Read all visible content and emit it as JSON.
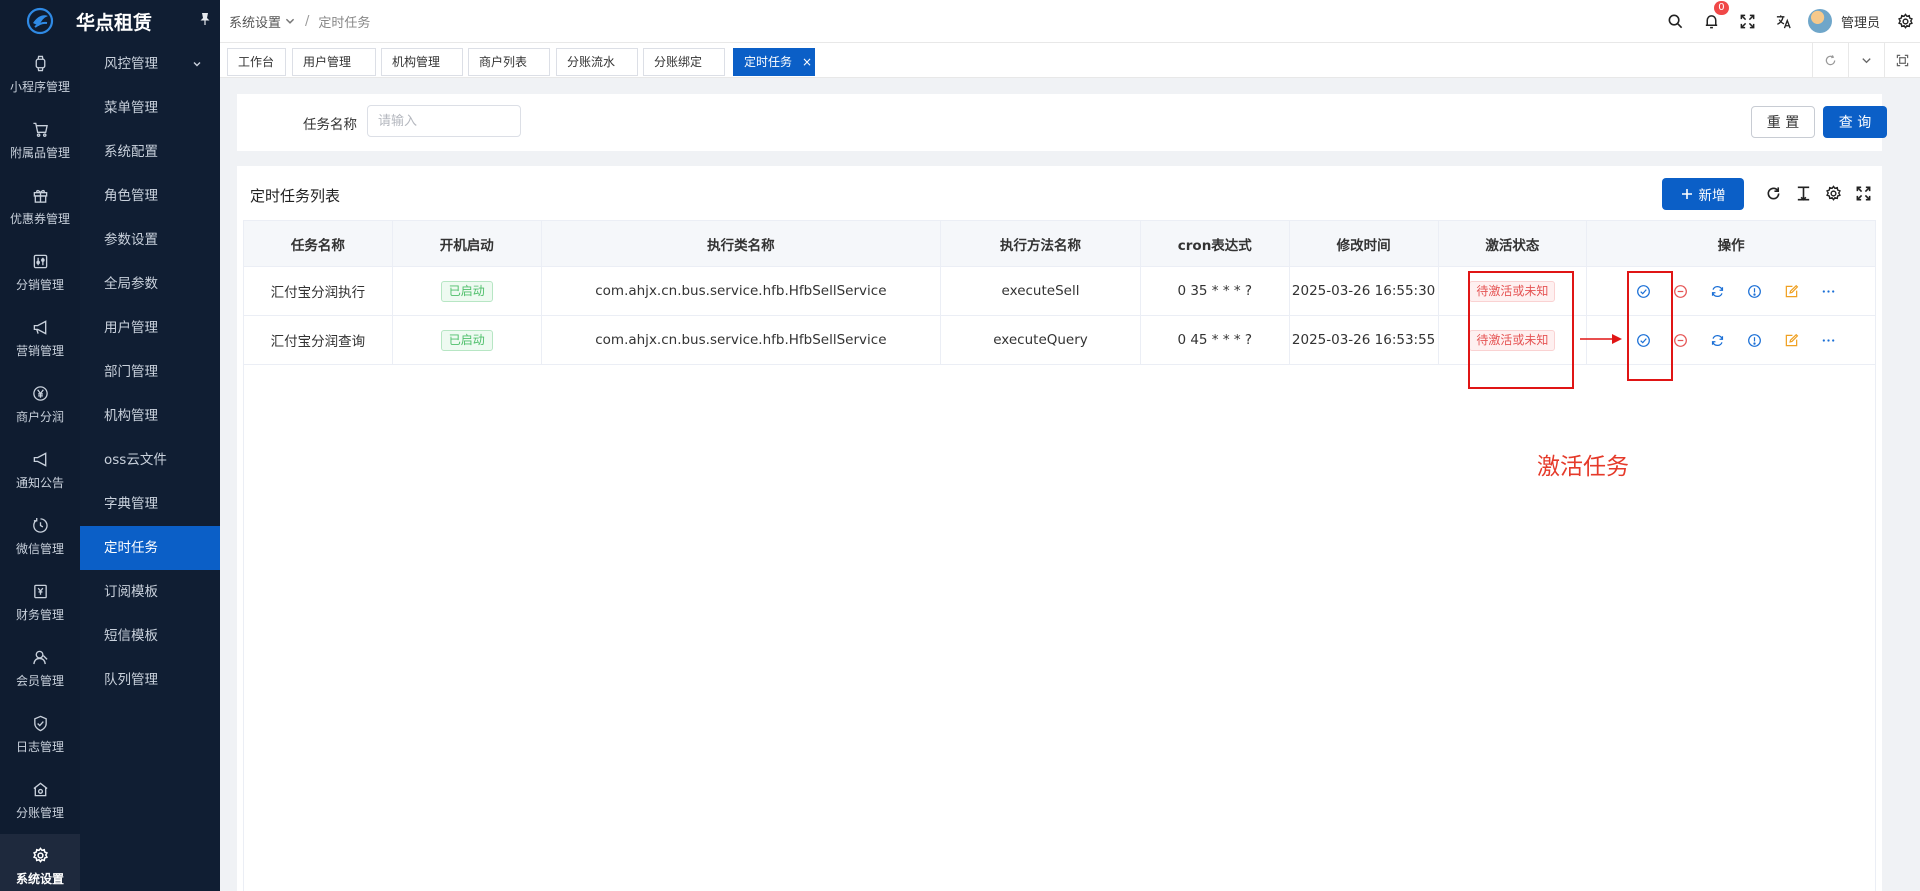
{
  "brand": {
    "name": "华点租赁"
  },
  "rail": [
    {
      "label": "小程序管理",
      "icon": "watch-icon"
    },
    {
      "label": "附属品管理",
      "icon": "cart-icon"
    },
    {
      "label": "优惠券管理",
      "icon": "gift-icon"
    },
    {
      "label": "分销管理",
      "icon": "sliders-icon"
    },
    {
      "label": "营销管理",
      "icon": "megaphone-icon"
    },
    {
      "label": "商户分润",
      "icon": "yen-icon"
    },
    {
      "label": "通知公告",
      "icon": "notice-icon"
    },
    {
      "label": "微信管理",
      "icon": "clock-icon"
    },
    {
      "label": "财务管理",
      "icon": "finance-icon"
    },
    {
      "label": "会员管理",
      "icon": "user-icon"
    },
    {
      "label": "日志管理",
      "icon": "shield-icon"
    },
    {
      "label": "分账管理",
      "icon": "home-icon"
    },
    {
      "label": "系统设置",
      "icon": "gear-icon"
    }
  ],
  "submenu": [
    "风控管理",
    "菜单管理",
    "系统配置",
    "角色管理",
    "参数设置",
    "全局参数",
    "用户管理",
    "部门管理",
    "机构管理",
    "oss云文件",
    "字典管理",
    "定时任务",
    "订阅模板",
    "短信模板",
    "队列管理"
  ],
  "breadcrumb": {
    "parent": "系统设置",
    "separator": "/",
    "current": "定时任务"
  },
  "header": {
    "notification_count": "0",
    "user_name": "管理员"
  },
  "tabs": [
    "工作台",
    "用户管理",
    "机构管理",
    "商户列表",
    "分账流水",
    "分账绑定",
    "定时任务"
  ],
  "tab_close": "×",
  "search": {
    "label": "任务名称",
    "placeholder": "请输入",
    "value": "",
    "reset_label": "重 置",
    "query_label": "查 询"
  },
  "list": {
    "title": "定时任务列表",
    "add_label": "新增"
  },
  "table": {
    "columns": [
      "任务名称",
      "开机启动",
      "执行类名称",
      "执行方法名称",
      "cron表达式",
      "修改时间",
      "激活状态",
      "操作"
    ],
    "rows": [
      {
        "name": "汇付宝分润执行",
        "boot": "已启动",
        "class": "com.ahjx.cn.bus.service.hfb.HfbSellService",
        "method": "executeSell",
        "cron": "0 35 * * * ?",
        "modified": "2025-03-26 16:55:30",
        "status": "待激活或未知"
      },
      {
        "name": "汇付宝分润查询",
        "boot": "已启动",
        "class": "com.ahjx.cn.bus.service.hfb.HfbSellService",
        "method": "executeQuery",
        "cron": "0 45 * * * ?",
        "modified": "2025-03-26 16:53:55",
        "status": "待激活或未知"
      }
    ]
  },
  "annotation": {
    "text": "激活任务",
    "color": "#e01515"
  },
  "colors": {
    "primary": "#0b5fc7",
    "sidebar": "#0f1c30",
    "success": "#4fbf6b",
    "danger": "#e55454",
    "warning": "#f0a020"
  }
}
